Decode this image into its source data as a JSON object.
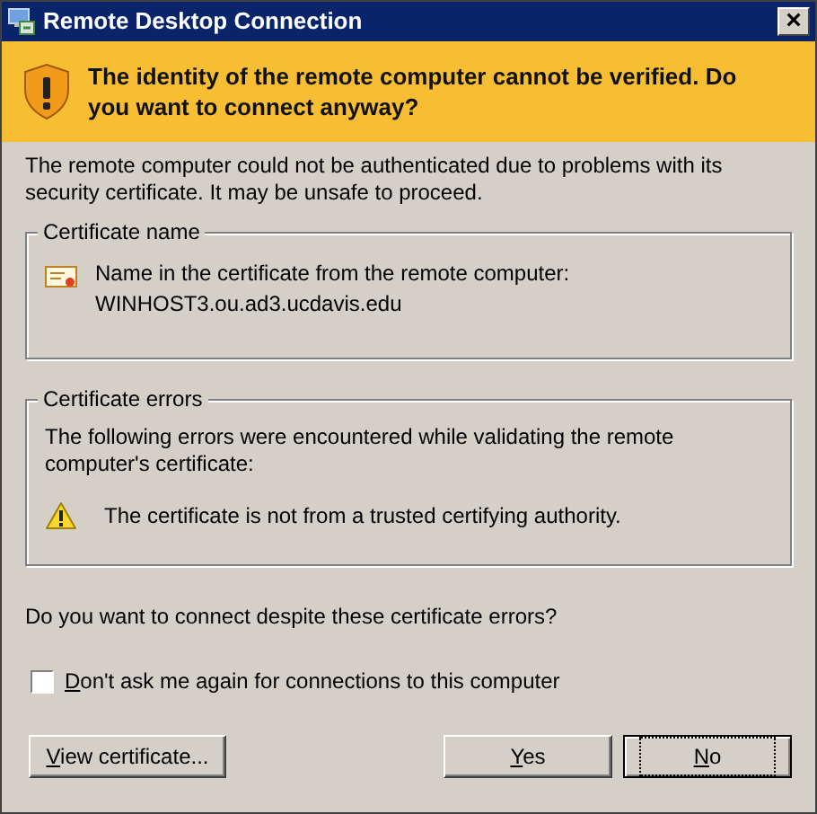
{
  "window": {
    "title": "Remote Desktop Connection",
    "close_glyph": "×"
  },
  "banner": {
    "message": "The identity of the remote computer cannot be verified. Do you want to connect anyway?"
  },
  "intro": "The remote computer could not be authenticated due to problems with its security certificate. It may be unsafe to proceed.",
  "certificate_name": {
    "legend": "Certificate name",
    "caption": "Name in the certificate from the remote computer:",
    "value": "WINHOST3.ou.ad3.ucdavis.edu"
  },
  "certificate_errors": {
    "legend": "Certificate errors",
    "description": "The following errors were encountered while validating the remote computer's certificate:",
    "errors": [
      "The certificate is not from a trusted certifying authority."
    ]
  },
  "question": "Do you want to connect despite these certificate errors?",
  "checkbox": {
    "mnemonic": "D",
    "label_rest": "on't ask me again for connections to this computer",
    "checked": false
  },
  "buttons": [
    {
      "mnemonic": "V",
      "label_rest": "iew certificate...",
      "default": false
    },
    {
      "mnemonic": "Y",
      "label_rest": "es",
      "default": false
    },
    {
      "mnemonic": "N",
      "label_rest": "o",
      "default": true
    }
  ]
}
